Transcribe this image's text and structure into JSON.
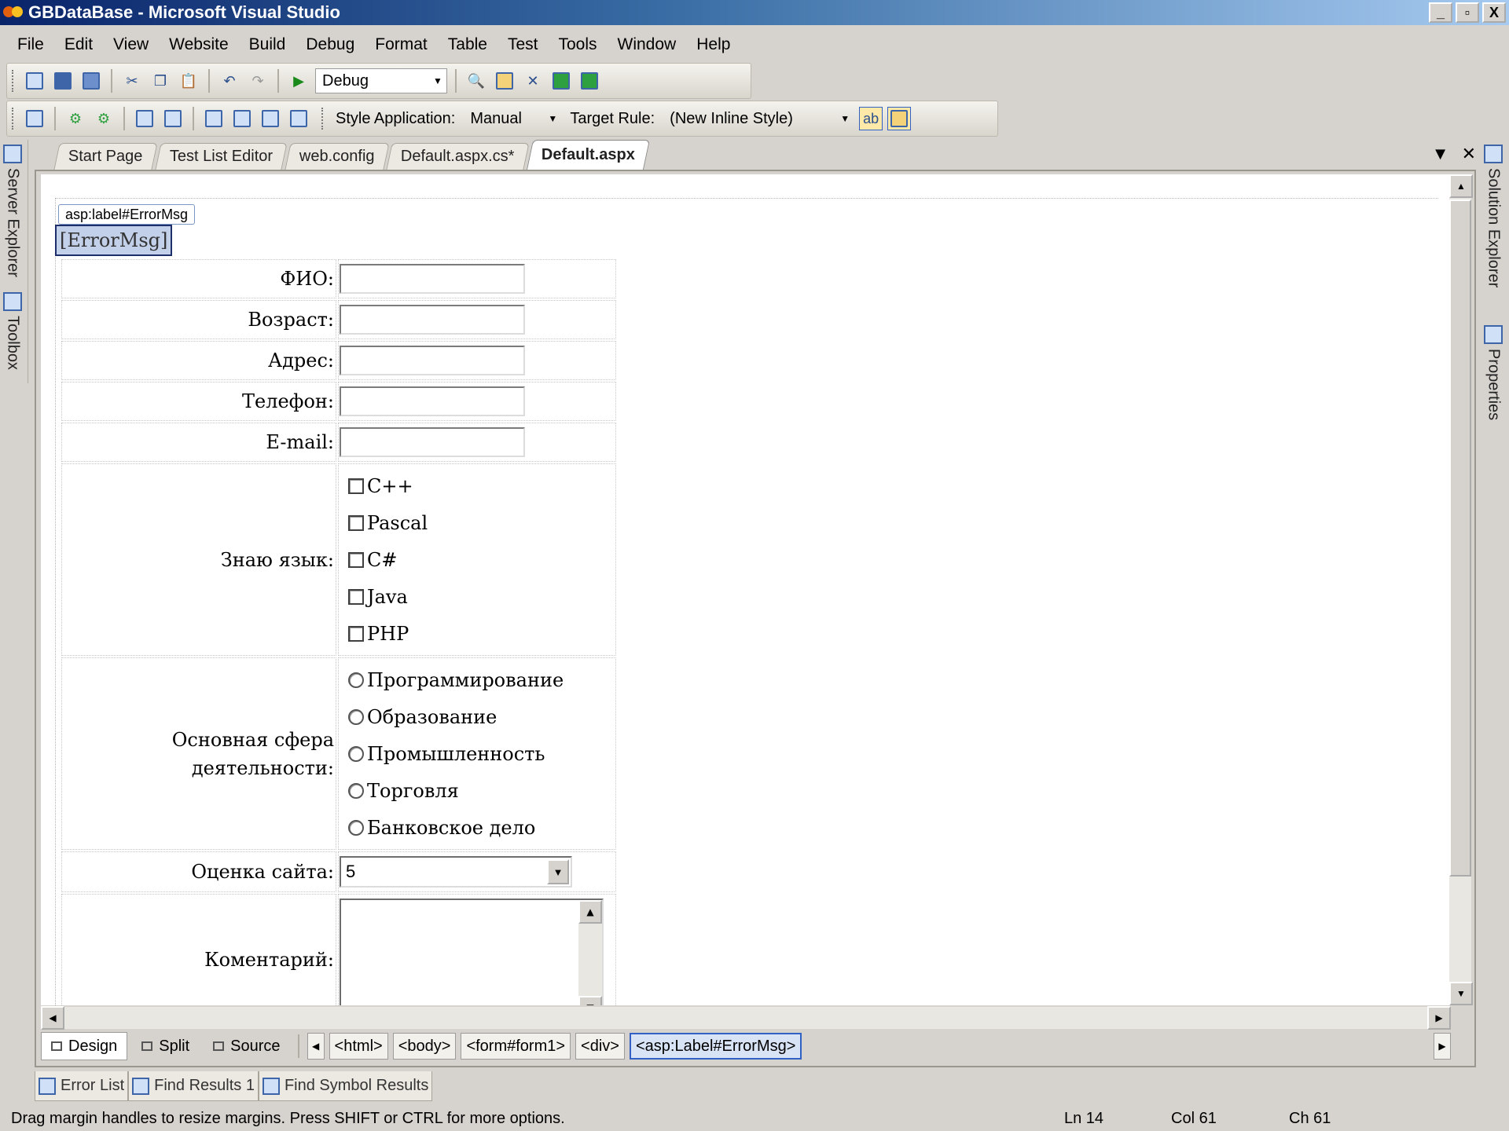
{
  "window": {
    "title": "GBDataBase - Microsoft Visual Studio",
    "min": "_",
    "restore": "▫",
    "close": "X"
  },
  "menu": [
    "File",
    "Edit",
    "View",
    "Website",
    "Build",
    "Debug",
    "Format",
    "Table",
    "Test",
    "Tools",
    "Window",
    "Help"
  ],
  "toolbar1": {
    "config": "Debug"
  },
  "toolbar2": {
    "style_app_label": "Style Application:",
    "style_app_value": "Manual",
    "target_rule_label": "Target Rule:",
    "target_rule_value": "(New Inline Style)"
  },
  "side": {
    "server_explorer": "Server Explorer",
    "toolbox": "Toolbox",
    "solution_explorer": "Solution Explorer",
    "properties": "Properties"
  },
  "tabs": [
    "Start Page",
    "Test List Editor",
    "web.config",
    "Default.aspx.cs*",
    "Default.aspx"
  ],
  "active_tab": "Default.aspx",
  "designer": {
    "tag_tip": "asp:label#ErrorMsg",
    "error_label": "[ErrorMsg]",
    "fields": [
      "ФИО:",
      "Возраст:",
      "Адрес:",
      "Телефон:",
      "E-mail:"
    ],
    "languages_label": "Знаю язык:",
    "languages": [
      "C++",
      "Pascal",
      "C#",
      "Java",
      "PHP"
    ],
    "sphere_label": "Основная сфера деятельности:",
    "spheres": [
      "Программирование",
      "Образование",
      "Промышленность",
      "Торговля",
      "Банковское дело"
    ],
    "rating_label": "Оценка сайта:",
    "rating_value": "5",
    "comment_label": "Коментарий:"
  },
  "views": [
    "Design",
    "Split",
    "Source"
  ],
  "breadcrumbs": [
    "<html>",
    "<body>",
    "<form#form1>",
    "<div>",
    "<asp:Label#ErrorMsg>"
  ],
  "tool_windows": [
    "Error List",
    "Find Results 1",
    "Find Symbol Results"
  ],
  "status": {
    "message": "Drag margin handles to resize margins. Press SHIFT or CTRL for more options.",
    "ln": "Ln 14",
    "col": "Col 61",
    "ch": "Ch 61"
  }
}
